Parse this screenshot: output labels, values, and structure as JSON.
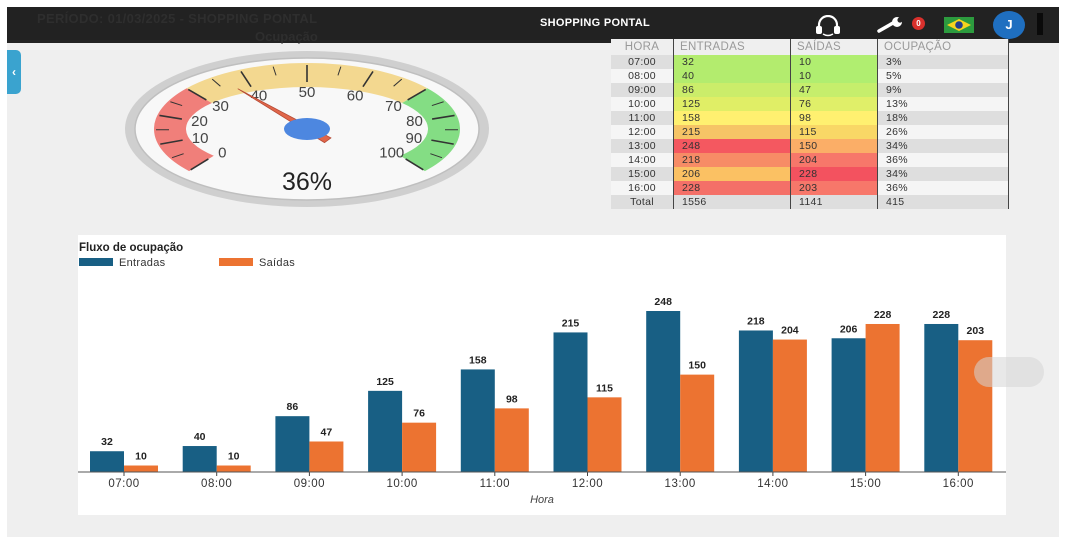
{
  "header": {
    "period": "PERÍODO: 01/03/2025 - SHOPPING PONTAL",
    "mall_name": "SHOPPING PONTAL",
    "notifications_count": "0",
    "user_initial": "J",
    "icons": [
      "headset-icon",
      "wrench-icon",
      "brazil-flag-icon"
    ]
  },
  "side_tab": {
    "icon": "chevron-left-icon",
    "glyph": "‹"
  },
  "gauge": {
    "title": "Ocupação",
    "value_label": "36%",
    "value_percent": 36,
    "ticks": [
      "0",
      "10",
      "20",
      "30",
      "40",
      "50",
      "60",
      "70",
      "80",
      "90",
      "100"
    ],
    "colors": {
      "low": "#f07f7a",
      "mid": "#f3d890",
      "high": "#84dd84",
      "needle": "#e0664a",
      "hub": "#4d87e0"
    }
  },
  "table": {
    "headers": [
      "HORA",
      "ENTRADAS",
      "SAÍDAS",
      "OCUPAÇÃO"
    ],
    "rows": [
      [
        "07:00",
        "32",
        "10",
        "3%"
      ],
      [
        "08:00",
        "40",
        "10",
        "5%"
      ],
      [
        "09:00",
        "86",
        "47",
        "9%"
      ],
      [
        "10:00",
        "125",
        "76",
        "13%"
      ],
      [
        "11:00",
        "158",
        "98",
        "18%"
      ],
      [
        "12:00",
        "215",
        "115",
        "26%"
      ],
      [
        "13:00",
        "248",
        "150",
        "34%"
      ],
      [
        "14:00",
        "218",
        "204",
        "36%"
      ],
      [
        "15:00",
        "206",
        "228",
        "34%"
      ],
      [
        "16:00",
        "228",
        "203",
        "36%"
      ]
    ],
    "total": [
      "Total",
      "1556",
      "1141",
      "415"
    ]
  },
  "chart_data": {
    "type": "bar",
    "title": "Fluxo de ocupação",
    "xlabel": "Hora",
    "ylabel": "",
    "categories": [
      "07:00",
      "08:00",
      "09:00",
      "10:00",
      "11:00",
      "12:00",
      "13:00",
      "14:00",
      "15:00",
      "16:00"
    ],
    "series": [
      {
        "name": "Entradas",
        "color": "#185f84",
        "values": [
          32,
          40,
          86,
          125,
          158,
          215,
          248,
          218,
          206,
          228
        ]
      },
      {
        "name": "Saídas",
        "color": "#ec7331",
        "values": [
          10,
          10,
          47,
          76,
          98,
          115,
          150,
          204,
          228,
          203
        ]
      }
    ],
    "ylim": [
      0,
      260
    ],
    "grid": false,
    "legend": "top-left"
  }
}
